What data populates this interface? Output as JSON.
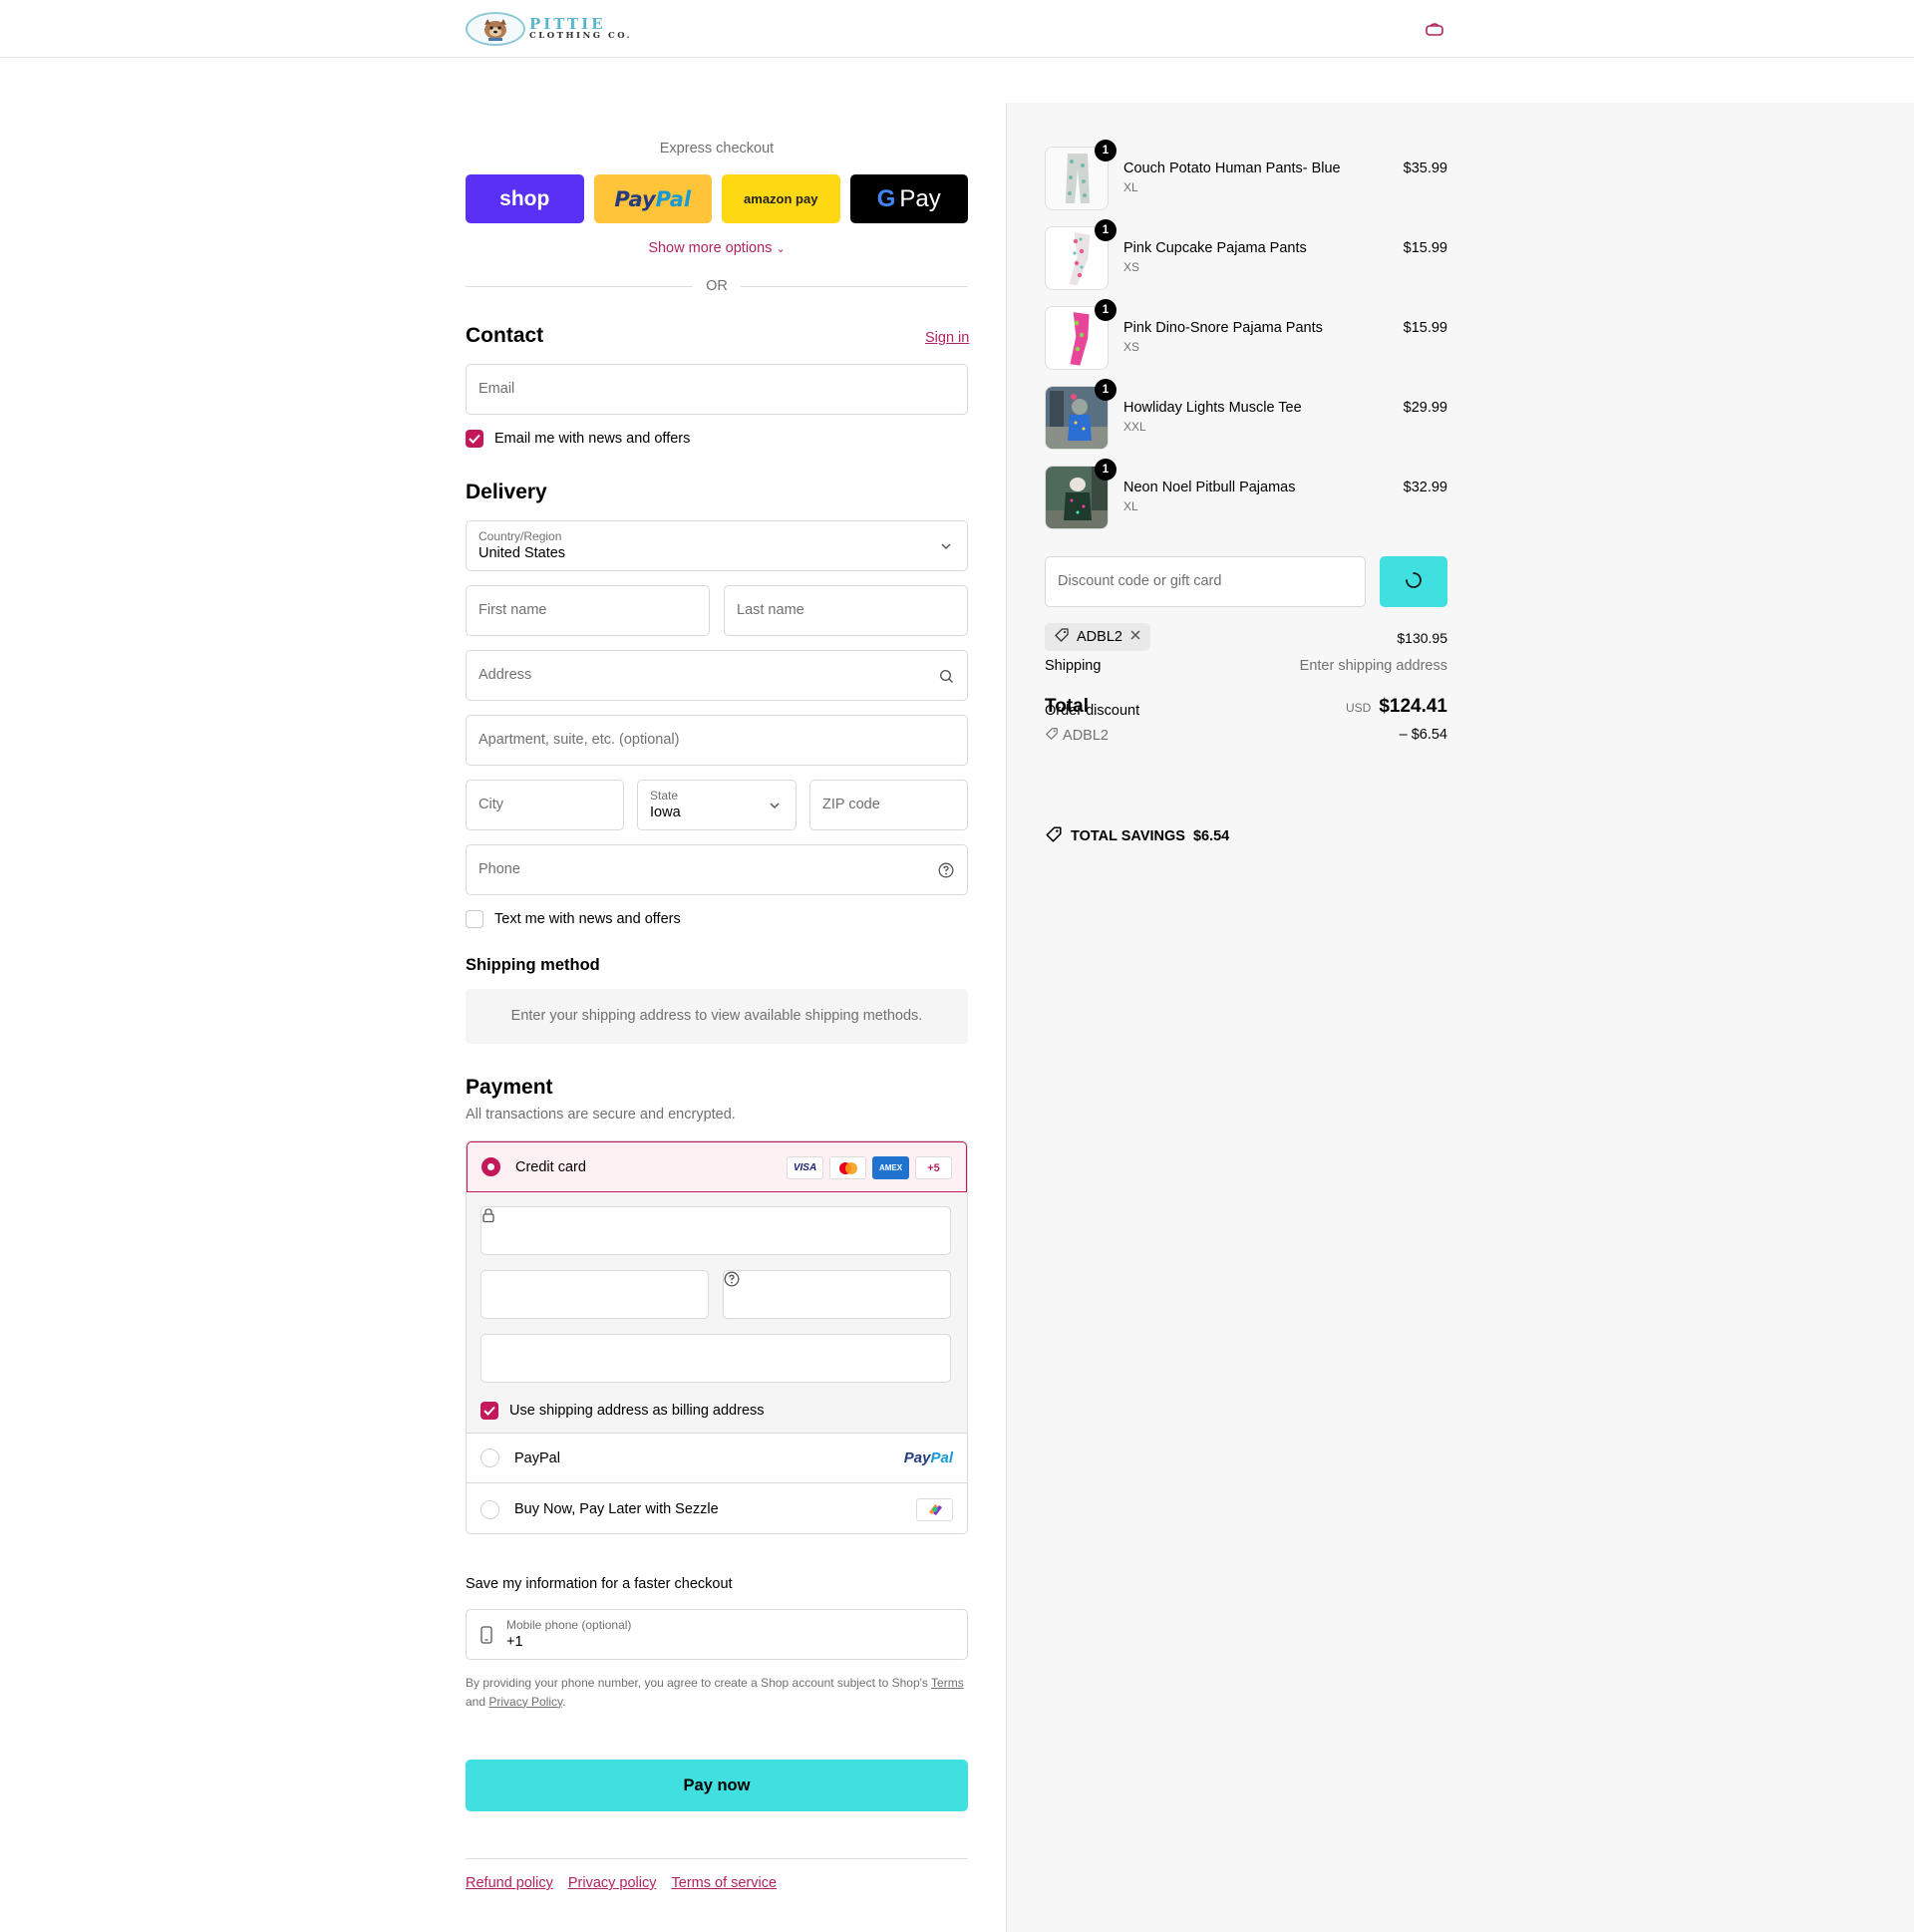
{
  "header": {
    "logo_line1": "PITTIE",
    "logo_line2": "CLOTHING CO.",
    "cart_icon": "bag-icon"
  },
  "express": {
    "title": "Express checkout",
    "buttons": [
      {
        "label": "shop",
        "name": "shop-pay-button"
      },
      {
        "label": "PayPal",
        "name": "paypal-button"
      },
      {
        "label": "amazon pay",
        "name": "amazon-pay-button"
      },
      {
        "label": "G Pay",
        "name": "google-pay-button"
      }
    ],
    "show_more": "Show more options",
    "or": "OR"
  },
  "contact": {
    "heading": "Contact",
    "sign_in": "Sign in",
    "email_placeholder": "Email",
    "email_news": "Email me with news and offers",
    "email_news_checked": true
  },
  "delivery": {
    "heading": "Delivery",
    "country_label": "Country/Region",
    "country_value": "United States",
    "first_name": "First name",
    "last_name": "Last name",
    "address": "Address",
    "apartment": "Apartment, suite, etc. (optional)",
    "city": "City",
    "state_label": "State",
    "state_value": "Iowa",
    "zip": "ZIP code",
    "phone": "Phone",
    "text_news": "Text me with news and offers",
    "text_news_checked": false
  },
  "shipping_method": {
    "heading": "Shipping method",
    "info": "Enter your shipping address to view available shipping methods."
  },
  "payment": {
    "heading": "Payment",
    "subtitle": "All transactions are secure and encrypted.",
    "credit_card": "Credit card",
    "card_logos": [
      "VISA",
      "Mastercard",
      "AMEX",
      "+5"
    ],
    "billing_same": "Use shipping address as billing address",
    "billing_same_checked": true,
    "paypal": "PayPal",
    "paypal_logo": "PayPal",
    "sezzle": "Buy Now, Pay Later with Sezzle"
  },
  "save_info": {
    "title": "Save my information for a faster checkout",
    "mobile_label": "Mobile phone (optional)",
    "mobile_value": "+1",
    "legal_prefix": "By providing your phone number, you agree to create a Shop account subject to Shop's ",
    "legal_terms": "Terms",
    "legal_and": " and ",
    "legal_privacy": "Privacy Policy",
    "legal_end": "."
  },
  "pay_now": "Pay now",
  "footer": {
    "links": [
      "Refund policy",
      "Privacy policy",
      "Terms of service"
    ]
  },
  "order": {
    "items": [
      {
        "name": "Couch Potato Human Pants- Blue",
        "variant": "XL",
        "price": "$35.99",
        "qty": "1"
      },
      {
        "name": "Pink Cupcake Pajama Pants",
        "variant": "XS",
        "price": "$15.99",
        "qty": "1"
      },
      {
        "name": "Pink Dino-Snore Pajama Pants",
        "variant": "XS",
        "price": "$15.99",
        "qty": "1"
      },
      {
        "name": "Howliday Lights Muscle Tee",
        "variant": "XXL",
        "price": "$29.99",
        "qty": "1"
      },
      {
        "name": "Neon Noel Pitbull Pajamas",
        "variant": "XL",
        "price": "$32.99",
        "qty": "1"
      }
    ],
    "discount_placeholder": "Discount code or gift card",
    "applied_code": "ADBL2",
    "subtotal": "$130.95",
    "shipping_label": "Shipping",
    "shipping_value": "Enter shipping address",
    "order_discount_label": "Order discount",
    "discount_code": "ADBL2",
    "discount_value": "– $6.54",
    "total_label": "Total",
    "currency": "USD",
    "total": "$124.41",
    "savings_label": "TOTAL SAVINGS",
    "savings_value": "$6.54"
  },
  "colors": {
    "accent": "#b4235f",
    "checkbox": "#c3185a",
    "primary_button": "#41e0e0",
    "shop_pay": "#5a31f4",
    "paypal": "#ffc439",
    "amazon": "#ffd814"
  }
}
